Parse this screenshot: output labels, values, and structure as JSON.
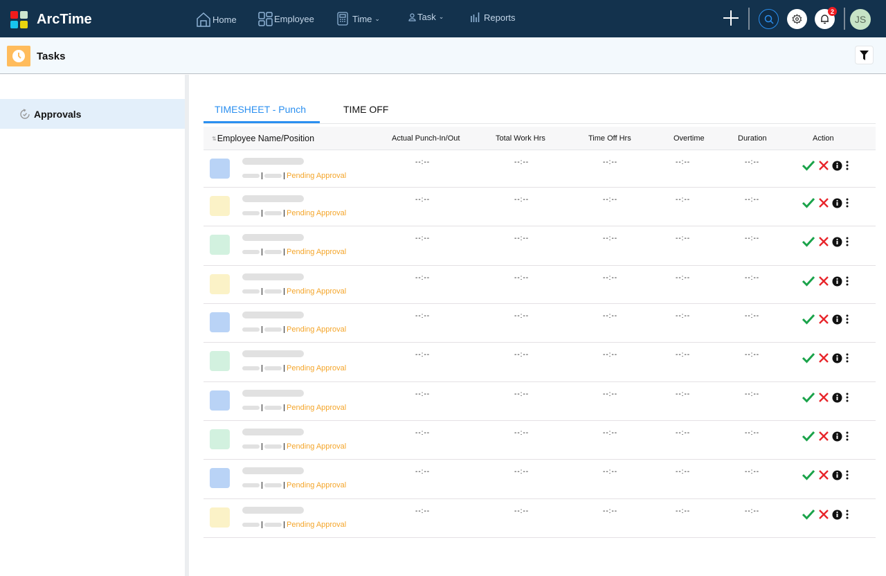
{
  "app": {
    "name": "ArcTime",
    "logo_colors": [
      "#ef1c1c",
      "#cde6cf",
      "#18c4ee",
      "#e8d40e"
    ]
  },
  "nav": {
    "items": [
      {
        "label": "Home",
        "icon": "home-icon",
        "has_dropdown": false
      },
      {
        "label": "Employee",
        "icon": "grid-icon",
        "has_dropdown": false
      },
      {
        "label": "Time",
        "icon": "calculator-icon",
        "has_dropdown": true
      },
      {
        "label": "Task",
        "icon": "person-icon",
        "has_dropdown": true
      },
      {
        "label": "Reports",
        "icon": "bar-chart-icon",
        "has_dropdown": false
      }
    ],
    "notification_count": "2",
    "user_initials": "JS"
  },
  "page": {
    "title": "Tasks",
    "icon": "clock-icon"
  },
  "sidebar": {
    "items": [
      {
        "label": "Approvals",
        "icon": "refresh-check-icon",
        "active": true
      }
    ]
  },
  "tabs": [
    {
      "label": "TIMESHEET - Punch",
      "active": true
    },
    {
      "label": "TIME OFF",
      "active": false
    }
  ],
  "table": {
    "columns": [
      "Employee Name/Position",
      "Actual Punch-In/Out",
      "Total Work Hrs",
      "Time Off Hrs",
      "Overtime",
      "Duration",
      "Action"
    ],
    "rows": [
      {
        "avatar_color": "#b9d3f6",
        "status": "Pending Approval",
        "punch": "--:--",
        "total": "--:--",
        "timeoff": "--:--",
        "overtime": "--:--",
        "duration": "--:--"
      },
      {
        "avatar_color": "#fbf2c7",
        "status": "Pending Approval",
        "punch": "--:--",
        "total": "--:--",
        "timeoff": "--:--",
        "overtime": "--:--",
        "duration": "--:--"
      },
      {
        "avatar_color": "#d2f1df",
        "status": "Pending Approval",
        "punch": "--:--",
        "total": "--:--",
        "timeoff": "--:--",
        "overtime": "--:--",
        "duration": "--:--"
      },
      {
        "avatar_color": "#fbf2c7",
        "status": "Pending Approval",
        "punch": "--:--",
        "total": "--:--",
        "timeoff": "--:--",
        "overtime": "--:--",
        "duration": "--:--"
      },
      {
        "avatar_color": "#b9d3f6",
        "status": "Pending Approval",
        "punch": "--:--",
        "total": "--:--",
        "timeoff": "--:--",
        "overtime": "--:--",
        "duration": "--:--"
      },
      {
        "avatar_color": "#d2f1df",
        "status": "Pending Approval",
        "punch": "--:--",
        "total": "--:--",
        "timeoff": "--:--",
        "overtime": "--:--",
        "duration": "--:--"
      },
      {
        "avatar_color": "#b9d3f6",
        "status": "Pending Approval",
        "punch": "--:--",
        "total": "--:--",
        "timeoff": "--:--",
        "overtime": "--:--",
        "duration": "--:--"
      },
      {
        "avatar_color": "#d2f1df",
        "status": "Pending Approval",
        "punch": "--:--",
        "total": "--:--",
        "timeoff": "--:--",
        "overtime": "--:--",
        "duration": "--:--"
      },
      {
        "avatar_color": "#b9d3f6",
        "status": "Pending Approval",
        "punch": "--:--",
        "total": "--:--",
        "timeoff": "--:--",
        "overtime": "--:--",
        "duration": "--:--"
      },
      {
        "avatar_color": "#fbf2c7",
        "status": "Pending Approval",
        "punch": "--:--",
        "total": "--:--",
        "timeoff": "--:--",
        "overtime": "--:--",
        "duration": "--:--"
      }
    ],
    "action_icons": [
      "approve-check-icon",
      "reject-x-icon",
      "info-icon",
      "more-vertical-icon"
    ]
  },
  "colors": {
    "topbar": "#13324d",
    "accent": "#2a8ff0",
    "pending": "#f4a52a",
    "approve": "#1aa34a",
    "reject": "#e8252a"
  }
}
